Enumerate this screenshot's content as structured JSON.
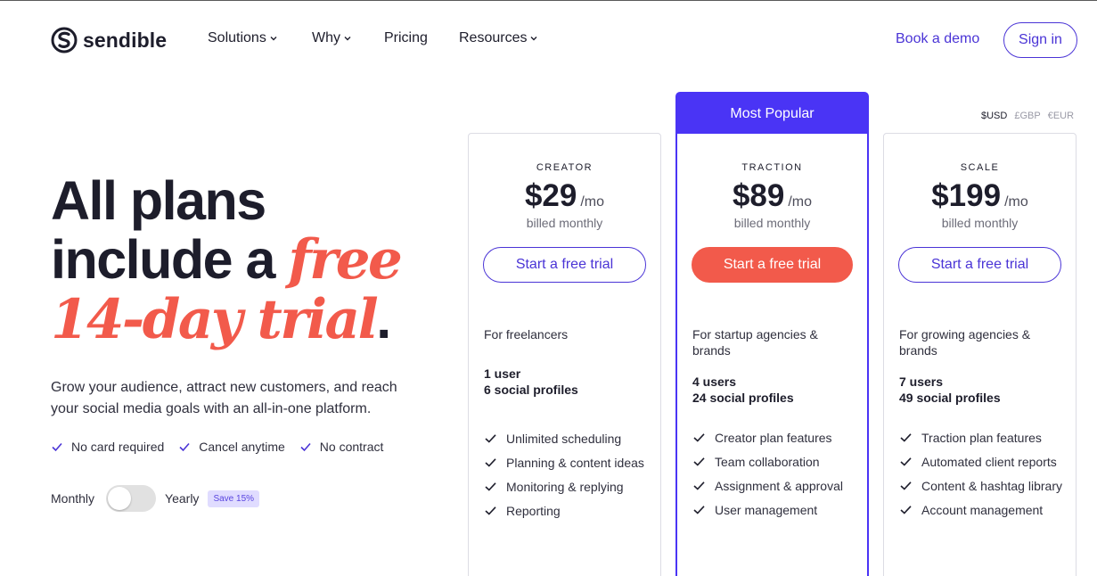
{
  "brand": {
    "name": "sendible"
  },
  "nav": {
    "items": [
      {
        "label": "Solutions",
        "has_dropdown": true
      },
      {
        "label": "Why",
        "has_dropdown": true
      },
      {
        "label": "Pricing",
        "has_dropdown": false
      },
      {
        "label": "Resources",
        "has_dropdown": true
      }
    ],
    "book_demo": "Book a demo",
    "sign_in": "Sign in"
  },
  "hero": {
    "headline_line1": "All plans",
    "headline_line2_plain": "include a ",
    "headline_line2_accent": "free",
    "headline_line3_accent": "14-day trial",
    "headline_period": ".",
    "subtext": "Grow your audience, attract new customers, and reach your social media goals with an all-in-one platform.",
    "checks": [
      "No card required",
      "Cancel anytime",
      "No contract"
    ],
    "billing_monthly": "Monthly",
    "billing_yearly": "Yearly",
    "billing_toggle_yearly": false,
    "save_badge": "Save 15%"
  },
  "currency": {
    "options": [
      "$USD",
      "£GBP",
      "€EUR"
    ],
    "selected": "$USD"
  },
  "plans": [
    {
      "name": "CREATOR",
      "price": "$29",
      "period": "/mo",
      "billed": "billed monthly",
      "cta": "Start a free trial",
      "for": "For freelancers",
      "users": "1 user",
      "profiles": "6 social profiles",
      "features": [
        "Unlimited scheduling",
        "Planning & content ideas",
        "Monitoring & replying",
        "Reporting"
      ]
    },
    {
      "name": "TRACTION",
      "badge": "Most Popular",
      "price": "$89",
      "period": "/mo",
      "billed": "billed monthly",
      "cta": "Start a free trial",
      "for": "For startup agencies & brands",
      "users": "4 users",
      "profiles": "24 social profiles",
      "features": [
        "Creator plan features",
        "Team collaboration",
        "Assignment & approval",
        "User management"
      ]
    },
    {
      "name": "SCALE",
      "price": "$199",
      "period": "/mo",
      "billed": "billed monthly",
      "cta": "Start a free trial",
      "for": "For growing agencies & brands",
      "users": "7 users",
      "profiles": "49 social profiles",
      "features": [
        "Traction plan features",
        "Automated client reports",
        "Content & hashtag library",
        "Account management"
      ]
    }
  ],
  "colors": {
    "accent_purple": "#4a34f5",
    "link_purple": "#4a34d6",
    "accent_coral": "#f25a4b",
    "text_dark": "#1d1d2b",
    "save_badge_bg": "#e0dcff"
  }
}
